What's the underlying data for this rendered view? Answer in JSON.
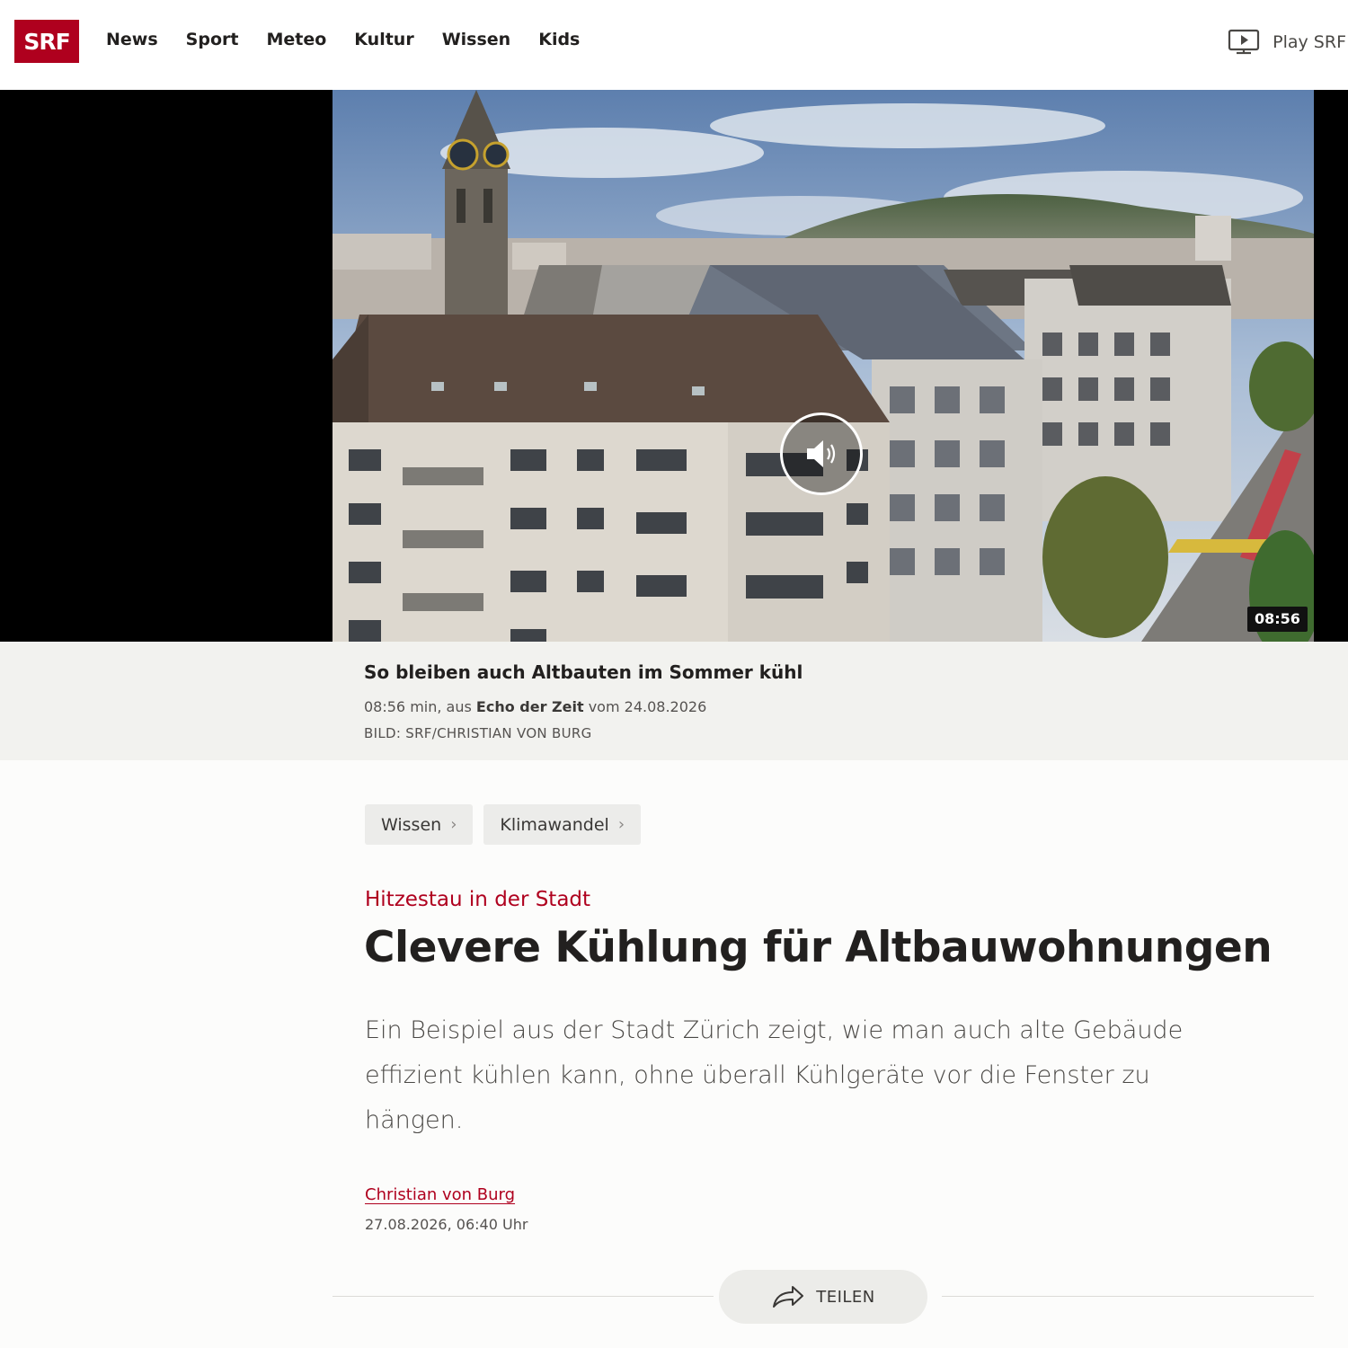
{
  "header": {
    "logo": "SRF",
    "nav": [
      "News",
      "Sport",
      "Meteo",
      "Kultur",
      "Wissen",
      "Kids"
    ],
    "play_label": "Play SRF"
  },
  "video": {
    "duration": "08:56",
    "title": "So bleiben auch Altbauten im Sommer kühl",
    "meta_prefix": "08:56 min, aus ",
    "show": "Echo der Zeit",
    "meta_suffix": " vom 24.08.2026",
    "credit": "BILD: SRF/CHRISTIAN VON BURG"
  },
  "breadcrumbs": [
    "Wissen",
    "Klimawandel"
  ],
  "article": {
    "kicker": "Hitzestau in der Stadt",
    "title": "Clevere Kühlung für Altbauwohnungen",
    "lead": "Ein Beispiel aus der Stadt Zürich zeigt, wie man auch alte Gebäude effizient kühlen kann, ohne überall Kühlgeräte vor die Fenster zu hängen.",
    "author": "Christian von Burg",
    "date": "27.08.2026, 06:40 Uhr"
  },
  "share": {
    "label": "TEILEN"
  },
  "colors": {
    "brand": "#af001e",
    "text": "#22201f",
    "caption_bg": "#f2f2ef"
  }
}
